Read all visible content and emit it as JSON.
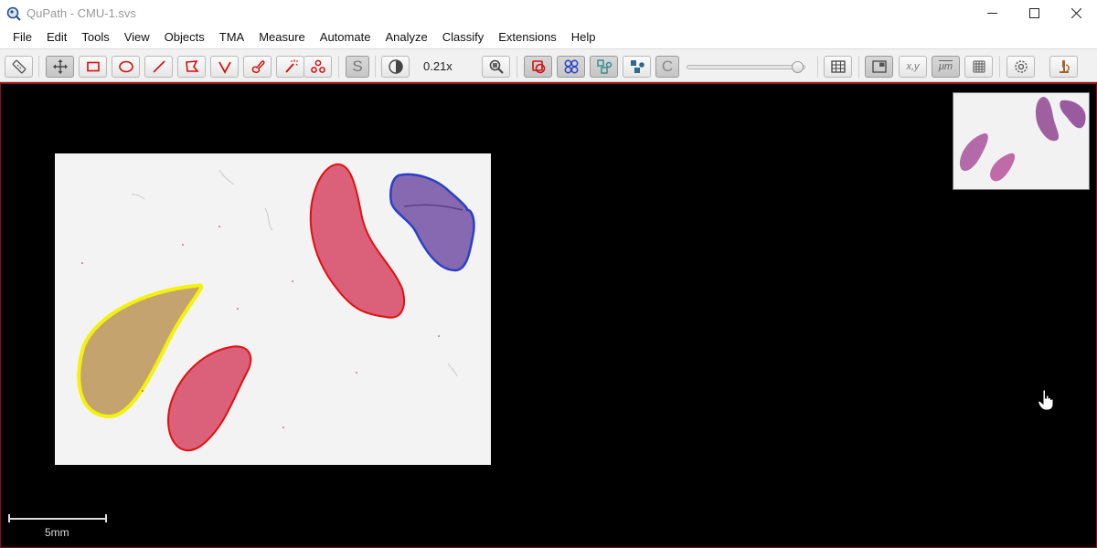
{
  "window": {
    "title": "QuPath - CMU-1.svs"
  },
  "menu": [
    "File",
    "Edit",
    "Tools",
    "View",
    "Objects",
    "TMA",
    "Measure",
    "Automate",
    "Analyze",
    "Classify",
    "Extensions",
    "Help"
  ],
  "toolbar": {
    "zoom_label": "0.21x",
    "opacity_slider_value": 0.93,
    "xy_label": "x,y",
    "um_label": "μm",
    "s_label": "S",
    "c_label": "C"
  },
  "viewer": {
    "scale_label": "5mm"
  },
  "colors": {
    "annotation_red": "#e01010",
    "annotation_blue": "#2a3fc8",
    "annotation_yellow": "#f2f20a",
    "tissue_pink": "#d9546f",
    "tissue_purple": "#7a5aa8",
    "tissue_tan": "#c09a60"
  }
}
